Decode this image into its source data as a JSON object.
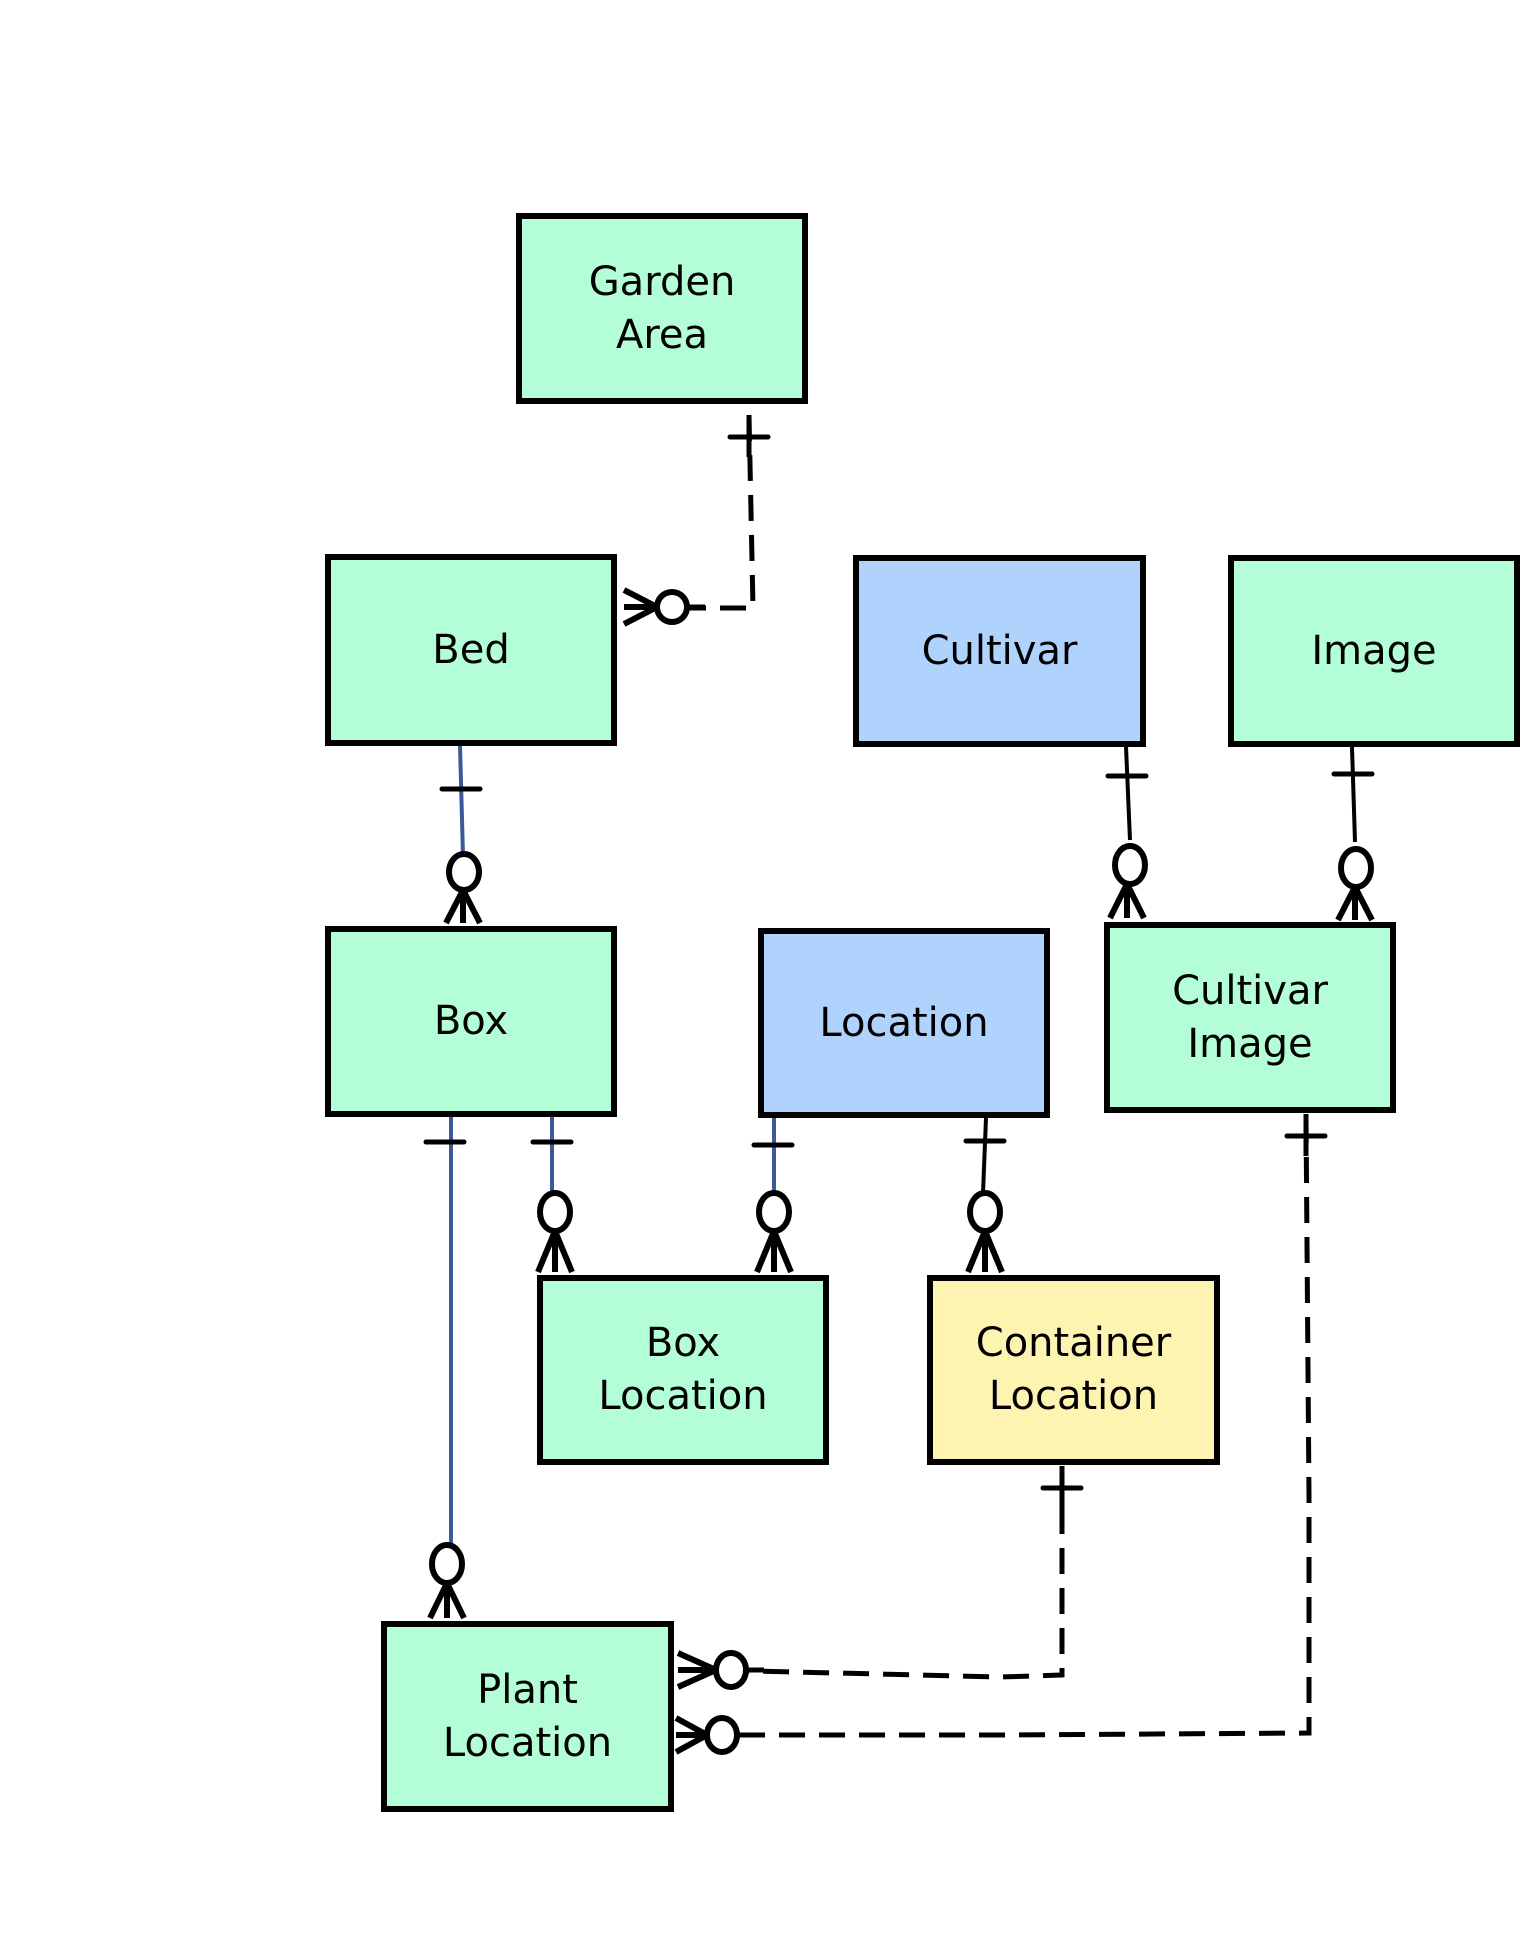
{
  "diagram": {
    "type": "entity-relationship",
    "colors": {
      "independent_entity": "#b3fed7",
      "reference_entity": "#afd3fd",
      "highlight_entity": "#fdf4b2",
      "identifying_line": "#3a5a99",
      "non_identifying_line": "#000000"
    },
    "entities": [
      {
        "id": "garden_area",
        "label": "Garden\nArea",
        "color": "green"
      },
      {
        "id": "bed",
        "label": "Bed",
        "color": "green"
      },
      {
        "id": "cultivar",
        "label": "Cultivar",
        "color": "blue"
      },
      {
        "id": "image",
        "label": "Image",
        "color": "green"
      },
      {
        "id": "box",
        "label": "Box",
        "color": "green"
      },
      {
        "id": "location",
        "label": "Location",
        "color": "blue"
      },
      {
        "id": "cultivar_image",
        "label": "Cultivar\nImage",
        "color": "green"
      },
      {
        "id": "box_location",
        "label": "Box\nLocation",
        "color": "green"
      },
      {
        "id": "container_location",
        "label": "Container\nLocation",
        "color": "yellow"
      },
      {
        "id": "plant_location",
        "label": "Plant\nLocation",
        "color": "green"
      }
    ],
    "relationships": [
      {
        "from": "garden_area",
        "to": "bed",
        "parent_cardinality": "exactly-one",
        "child_cardinality": "zero-or-many",
        "style": "dashed"
      },
      {
        "from": "bed",
        "to": "box",
        "parent_cardinality": "exactly-one",
        "child_cardinality": "zero-or-many",
        "style": "solid-identifying"
      },
      {
        "from": "cultivar",
        "to": "cultivar_image",
        "parent_cardinality": "exactly-one",
        "child_cardinality": "zero-or-many",
        "style": "solid"
      },
      {
        "from": "image",
        "to": "cultivar_image",
        "parent_cardinality": "exactly-one",
        "child_cardinality": "zero-or-many",
        "style": "solid"
      },
      {
        "from": "box",
        "to": "box_location",
        "parent_cardinality": "exactly-one",
        "child_cardinality": "zero-or-many",
        "style": "solid-identifying"
      },
      {
        "from": "location",
        "to": "box_location",
        "parent_cardinality": "exactly-one",
        "child_cardinality": "zero-or-many",
        "style": "solid-identifying"
      },
      {
        "from": "location",
        "to": "container_location",
        "parent_cardinality": "exactly-one",
        "child_cardinality": "zero-or-many",
        "style": "solid"
      },
      {
        "from": "box",
        "to": "plant_location",
        "parent_cardinality": "exactly-one",
        "child_cardinality": "zero-or-many",
        "style": "solid-identifying"
      },
      {
        "from": "container_location",
        "to": "plant_location",
        "parent_cardinality": "exactly-one",
        "child_cardinality": "zero-or-many",
        "style": "dashed"
      },
      {
        "from": "cultivar_image",
        "to": "plant_location",
        "parent_cardinality": "exactly-one",
        "child_cardinality": "zero-or-many",
        "style": "dashed"
      }
    ]
  }
}
